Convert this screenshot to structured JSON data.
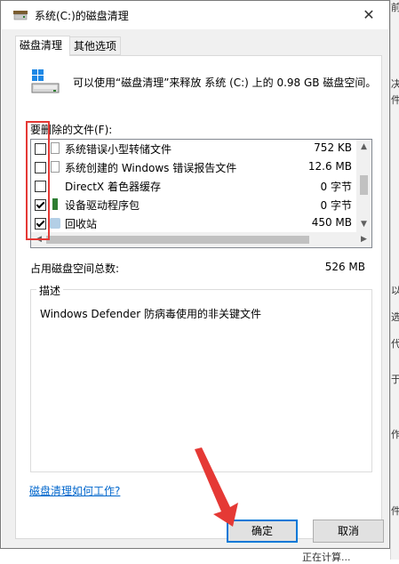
{
  "window": {
    "title": "系统(C:)的磁盘清理",
    "close_glyph": "✕"
  },
  "tabs": [
    {
      "label": "磁盘清理",
      "active": true
    },
    {
      "label": "其他选项",
      "active": false
    }
  ],
  "summary": "可以使用“磁盘清理”来释放 系统 (C:) 上的 0.98 GB 磁盘空间。",
  "files_label": "要删除的文件(F):",
  "files": [
    {
      "name": "系统错误小型转储文件",
      "size": "752 KB",
      "checked": false,
      "icon": "file-icon"
    },
    {
      "name": "系统创建的 Windows 错误报告文件",
      "size": "12.6 MB",
      "checked": false,
      "icon": "file-icon"
    },
    {
      "name": "DirectX 着色器缓存",
      "size": "0 字节",
      "checked": false,
      "icon": "blank-icon"
    },
    {
      "name": "设备驱动程序包",
      "size": "0 字节",
      "checked": true,
      "icon": "driver-icon"
    },
    {
      "name": "回收站",
      "size": "450 MB",
      "checked": true,
      "icon": "recycle-bin-icon"
    }
  ],
  "total": {
    "label": "占用磁盘空间总数:",
    "value": "526 MB"
  },
  "description": {
    "caption": "描述",
    "text": "Windows Defender 防病毒使用的非关键文件"
  },
  "help_link": "磁盘清理如何工作?",
  "buttons": {
    "ok": "确定",
    "cancel": "取消"
  },
  "background_fragments": [
    "前",
    "决",
    "件",
    "以",
    "选",
    "代",
    "于",
    "作",
    "件",
    "正在计算..."
  ],
  "colors": {
    "annotation_red": "#e53935",
    "link_blue": "#0066cc",
    "focus_blue": "#0078d7"
  }
}
